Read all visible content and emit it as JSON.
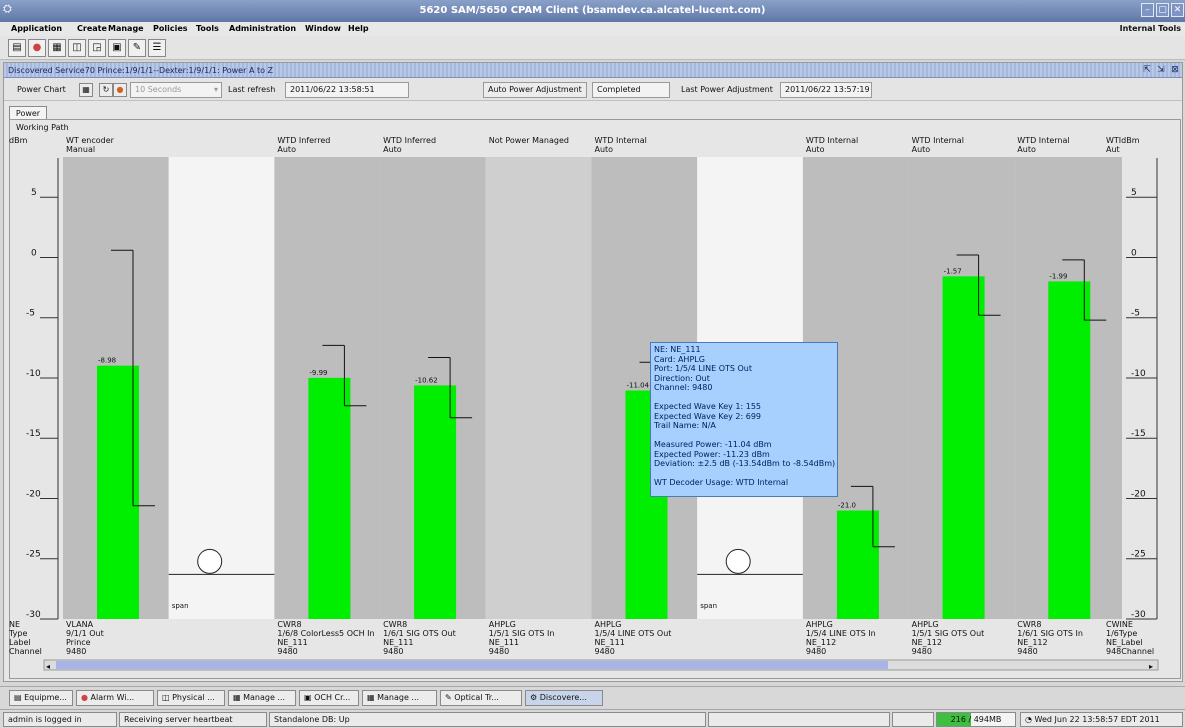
{
  "window": {
    "title": "5620 SAM/5650 CPAM Client (bsamdev.ca.alcatel-lucent.com)"
  },
  "menu": {
    "items": [
      "Application",
      "Create",
      "Manage",
      "Policies",
      "Tools",
      "Administration",
      "Window",
      "Help"
    ],
    "right": "Internal Tools"
  },
  "toolbar": {
    "icons": [
      "equipment-icon",
      "alarm-icon",
      "physical-topology-icon",
      "managed-object-icon",
      "och-icon",
      "manage-icon",
      "optical-trail-icon"
    ]
  },
  "internal_window": {
    "title": "Discovered Service70 Prince:1/9/1/1--Dexter:1/9/1/1: Power A to Z"
  },
  "power_bar": {
    "power_chart_label": "Power Chart",
    "interval": "10 Seconds",
    "last_refresh_label": "Last refresh",
    "last_refresh_value": "2011/06/22 13:58:51",
    "auto_power_label": "Auto Power Adjustment",
    "auto_power_status": "Completed",
    "last_adjust_label": "Last Power Adjustment",
    "last_adjust_value": "2011/06/22 13:57:19"
  },
  "tab": "Power",
  "working_path_label": "Working Path",
  "chart_data": {
    "type": "bar",
    "ylabel": "dBm",
    "yticks": [
      5,
      0,
      -5,
      -10,
      -15,
      -20,
      -25,
      -30
    ],
    "ylim": [
      -30,
      9
    ],
    "row_labels": [
      "NE",
      "Type",
      "Label",
      "Channel"
    ],
    "right_header": "WTIdBm",
    "right_sub": "Aut",
    "right_row_labels": [
      "CWINE",
      "1/6Type",
      "NE_Label",
      "948Channel"
    ],
    "columns": [
      {
        "kind": "bar",
        "header": "WT encoder",
        "sub": "Manual",
        "value": -8.98,
        "value_label": "-8.98",
        "target": 0.6,
        "lower": -20.6,
        "ne": "VLANA",
        "type": "9/1/1 Out",
        "label": "Prince",
        "channel": "9480"
      },
      {
        "kind": "span",
        "span_label": "span"
      },
      {
        "kind": "bar",
        "header": "WTD Inferred",
        "sub": "Auto",
        "value": -9.99,
        "value_label": "-9.99",
        "target": -7.3,
        "lower": -12.3,
        "ne": "CWR8",
        "type": "1/6/8 ColorLess5 OCH In",
        "label": "NE_111",
        "channel": "9480"
      },
      {
        "kind": "bar",
        "header": "WTD Inferred",
        "sub": "Auto",
        "value": -10.62,
        "value_label": "-10.62",
        "target": -8.3,
        "lower": -13.3,
        "ne": "CWR8",
        "type": "1/6/1 SIG OTS Out",
        "label": "NE_111",
        "channel": "9480"
      },
      {
        "kind": "empty",
        "header": "Not Power Managed",
        "sub": "",
        "ne": "AHPLG",
        "type": "1/5/1 SIG OTS In",
        "label": "NE_111",
        "channel": "9480"
      },
      {
        "kind": "bar",
        "header": "WTD Internal",
        "sub": "Auto",
        "value": -11.04,
        "value_label": "-11.04",
        "target": -8.7,
        "lower": -13.7,
        "ne": "AHPLG",
        "type": "1/5/4 LINE OTS Out",
        "label": "NE_111",
        "channel": "9480"
      },
      {
        "kind": "span",
        "span_label": "span"
      },
      {
        "kind": "bar",
        "header": "WTD Internal",
        "sub": "Auto",
        "value": -21.0,
        "value_label": "-21.0",
        "target": -19.0,
        "lower": -24.0,
        "ne": "AHPLG",
        "type": "1/5/4 LINE OTS In",
        "label": "NE_112",
        "channel": "9480"
      },
      {
        "kind": "bar",
        "header": "WTD Internal",
        "sub": "Auto",
        "value": -1.57,
        "value_label": "-1.57",
        "target": 0.2,
        "lower": -4.8,
        "ne": "AHPLG",
        "type": "1/5/1 SIG OTS Out",
        "label": "NE_112",
        "channel": "9480"
      },
      {
        "kind": "bar",
        "header": "WTD Internal",
        "sub": "Auto",
        "value": -1.99,
        "value_label": "-1.99",
        "target": -0.2,
        "lower": -5.2,
        "ne": "CWR8",
        "type": "1/6/1 SIG OTS In",
        "label": "NE_112",
        "channel": "9480"
      }
    ]
  },
  "tooltip": {
    "lines": [
      "NE: NE_111",
      "Card: AHPLG",
      "Port: 1/5/4 LINE OTS Out",
      "Direction: Out",
      "Channel: 9480",
      "",
      "Expected Wave Key 1: 155",
      "Expected Wave Key 2: 699",
      "Trail Name: N/A",
      "",
      "Measured Power: -11.04 dBm",
      "Expected Power: -11.23 dBm",
      "Deviation: ±2.5 dB (-13.54dBm to -8.54dBm)",
      "",
      "WT Decoder Usage: WTD Internal"
    ]
  },
  "taskbar": {
    "items": [
      "Equipme...",
      "Alarm Wi...",
      "Physical ...",
      "Manage ...",
      "OCH Cr...",
      "Manage ...",
      "Optical Tr...",
      "Discovere..."
    ]
  },
  "status": {
    "user": "admin is logged in",
    "heartbeat": "Receiving server heartbeat",
    "db": "Standalone DB: Up",
    "memory": "216 / 494MB",
    "memory_fraction": 0.437,
    "datetime": "Wed Jun 22 13:58:57 EDT 2011"
  }
}
